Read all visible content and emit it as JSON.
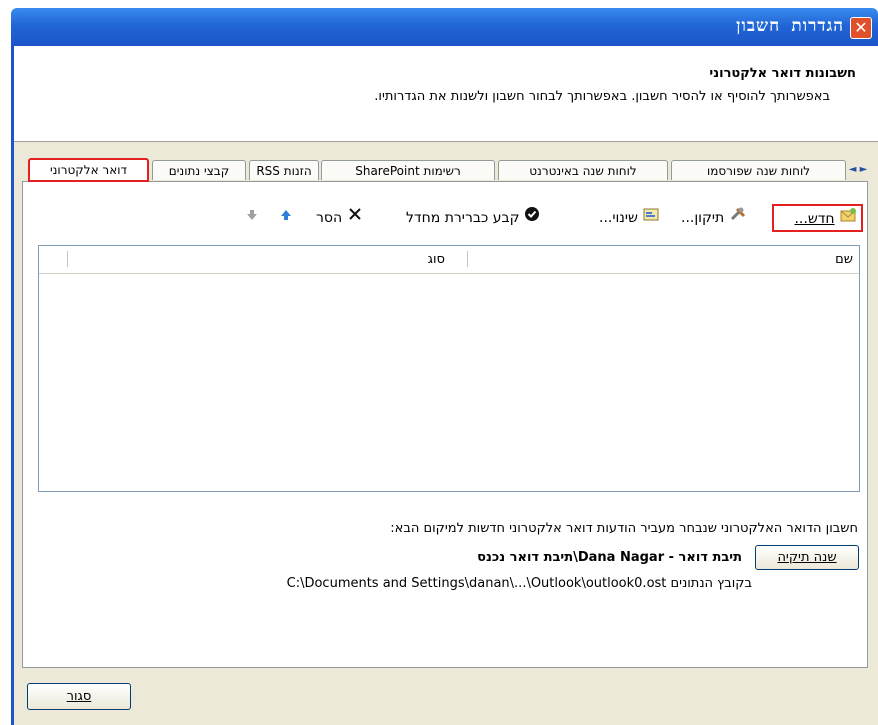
{
  "window": {
    "title": "הגדרות חשבון",
    "close_symbol": "✕"
  },
  "header": {
    "title": "חשבונות דואר אלקטרוני",
    "description": "באפשרותך להוסיף או להסיר חשבון. באפשרותך לבחור חשבון ולשנות את הגדרותיו."
  },
  "tabs": [
    {
      "label": "דואר אלקטרוני",
      "active": true
    },
    {
      "label": "קבצי נתונים"
    },
    {
      "label": "הזנות RSS"
    },
    {
      "label": "רשימות SharePoint"
    },
    {
      "label": "לוחות שנה באינטרנט"
    },
    {
      "label": "לוחות שנה שפורסמו"
    }
  ],
  "tab_scroll": "◄ ►",
  "toolbar": {
    "new": "חדש...",
    "repair": "תיקון...",
    "change": "שינוי...",
    "set_default": "קבע כברירת מחדל",
    "remove": "הסר"
  },
  "list": {
    "columns": {
      "name": "שם",
      "type": "סוג"
    },
    "rows": []
  },
  "delivery": {
    "text": "חשבון הדואר האלקטרוני שנבחר מעביר הודעות דואר אלקטרוני חדשות למיקום הבא:",
    "change_folder_button": "שנה תיקיה",
    "location": "תיבת דואר - Dana Nagar\\תיבת דואר נכנס",
    "path_prefix": "בקובץ הנתונים",
    "path": "C:\\Documents and Settings\\danan\\...\\Outlook\\outlook0.ost"
  },
  "footer": {
    "close_button": "סגור"
  },
  "colors": {
    "title_bar": "#2166d6",
    "highlight": "#e52020",
    "dialog_bg": "#ece9d8"
  }
}
